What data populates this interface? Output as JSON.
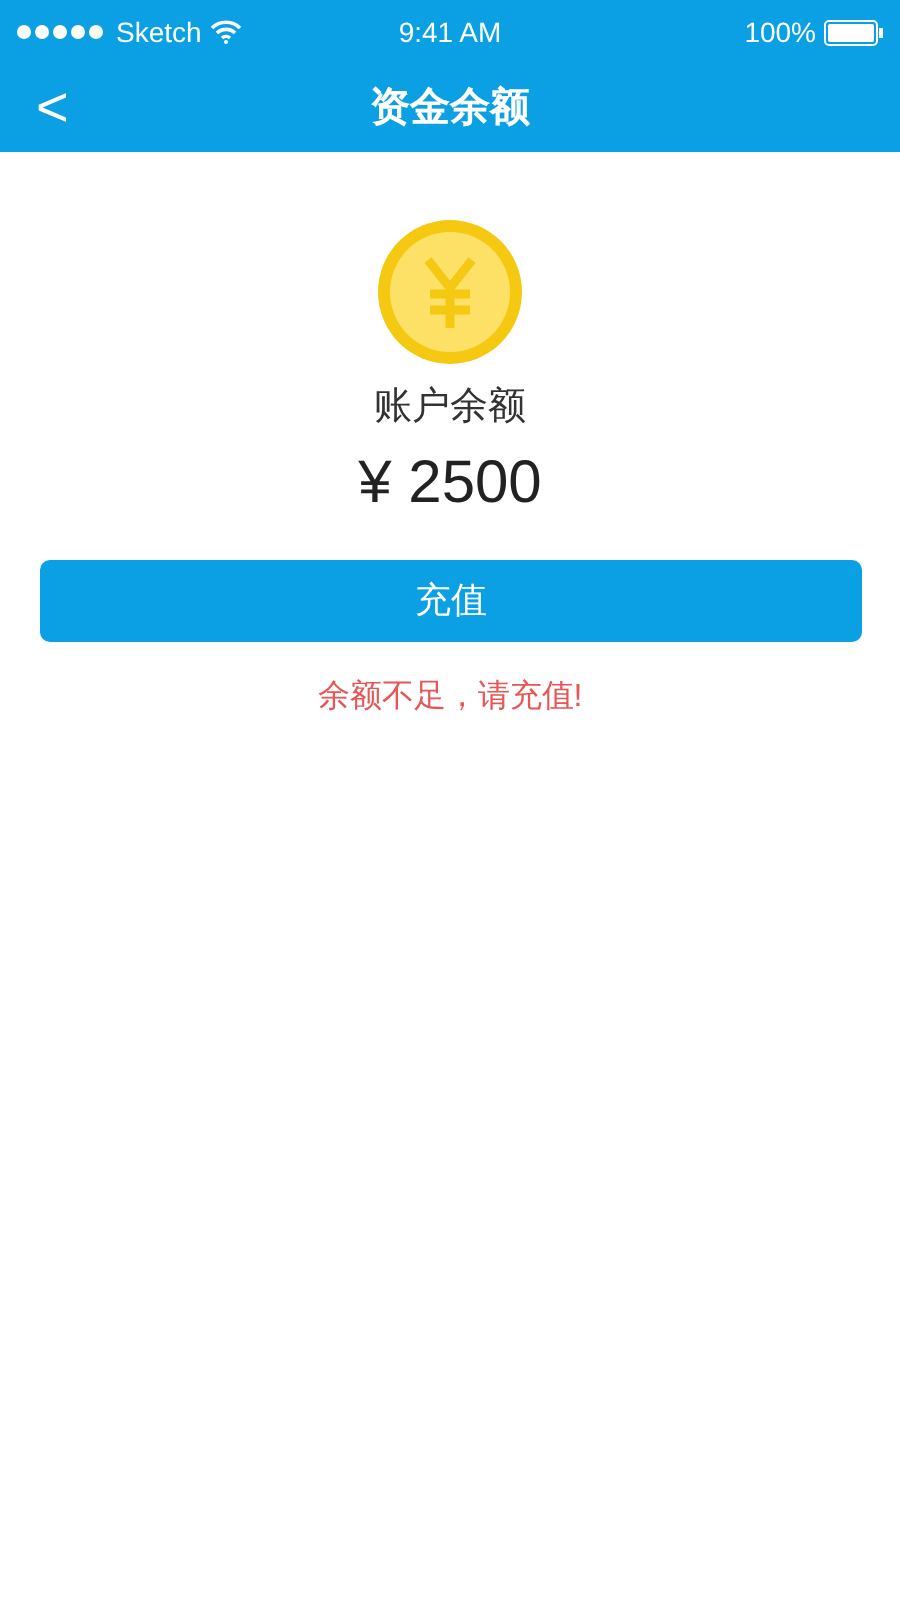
{
  "status_bar": {
    "carrier": "Sketch",
    "time": "9:41 AM",
    "battery": "100%"
  },
  "nav": {
    "back": "<",
    "title": "资金余额"
  },
  "balance": {
    "label": "账户余额",
    "amount": "¥ 2500"
  },
  "button": "充值",
  "warning": "余额不足，请充值!"
}
